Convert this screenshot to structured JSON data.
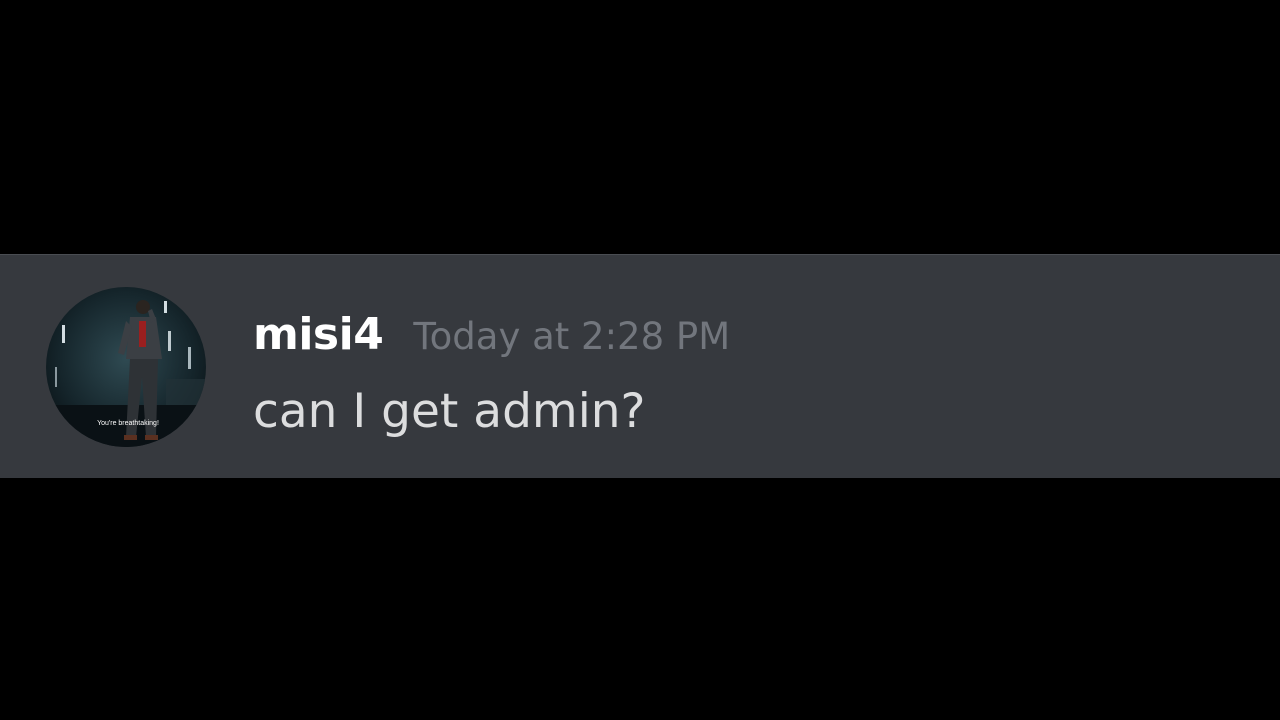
{
  "message": {
    "author": "misi4",
    "timestamp": "Today at 2:28 PM",
    "content": "can I get admin?",
    "avatar": {
      "icon": "user-avatar",
      "caption": "You're breathtaking!"
    }
  },
  "colors": {
    "background": "#000000",
    "message_background": "#36393e",
    "username": "#ffffff",
    "timestamp": "#72767d",
    "content": "#dcddde"
  }
}
